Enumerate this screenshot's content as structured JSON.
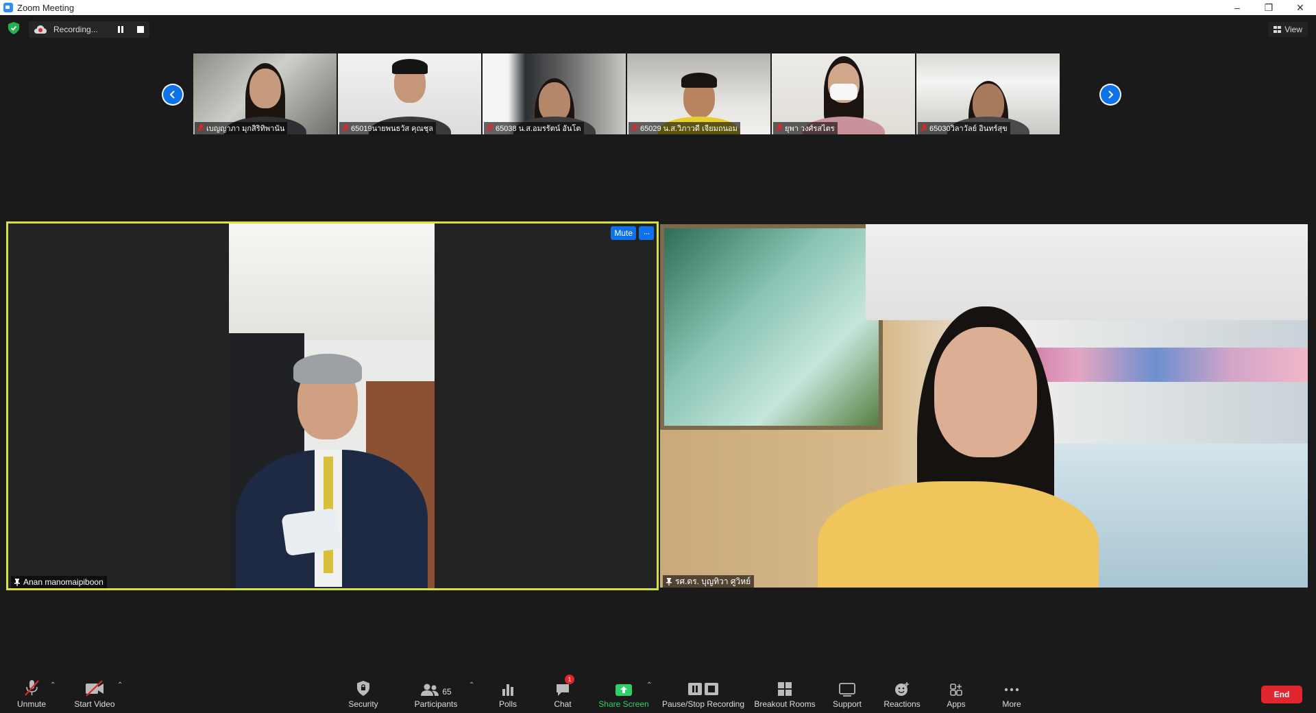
{
  "window": {
    "title": "Zoom Meeting",
    "minimize": "–",
    "restore": "❐",
    "close": "✕"
  },
  "topbar": {
    "recording_label": "Recording...",
    "view_label": "View"
  },
  "gallery_strip": [
    {
      "name": "เบญญาภา มุกสิริทิพานัน"
    },
    {
      "name": "65019นายพนธวัส คุณชุล"
    },
    {
      "name": "65038 น.ส.อมรรัตน์ อันโต"
    },
    {
      "name": "65029 น.ส.วิภาวดี เจียมถนอม"
    },
    {
      "name": "ยุพา วงศ์รสไตร"
    },
    {
      "name": "65030วิลาวัลย์ อินทร์สุข"
    }
  ],
  "main_tiles": {
    "left": {
      "name": "Anan manomaipiboon",
      "mute_label": "Mute",
      "more_label": "···"
    },
    "right": {
      "name": "รศ.ดร. บุญทิวา ศูวิหย์"
    }
  },
  "toolbar": {
    "unmute": "Unmute",
    "start_video": "Start Video",
    "security": "Security",
    "participants": "Participants",
    "participants_count": "65",
    "polls": "Polls",
    "chat": "Chat",
    "chat_badge": "1",
    "share_screen": "Share Screen",
    "pause_stop_recording": "Pause/Stop Recording",
    "breakout_rooms": "Breakout Rooms",
    "support": "Support",
    "reactions": "Reactions",
    "apps": "Apps",
    "more": "More",
    "end": "End"
  },
  "colors": {
    "accent_blue": "#0e72ed",
    "active_speaker_border": "#d7e33a",
    "share_green": "#2ed06a",
    "end_red": "#e0262f"
  }
}
